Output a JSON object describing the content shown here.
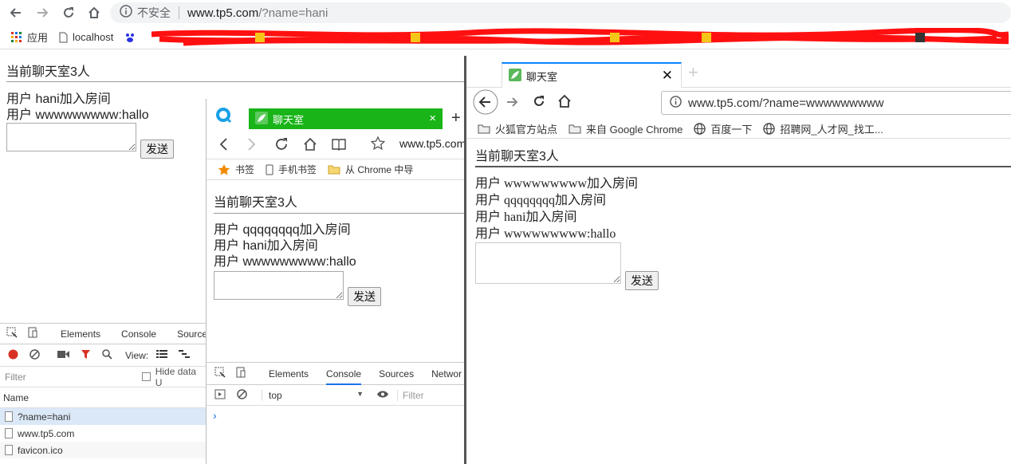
{
  "main_window": {
    "insecure_label": "不安全",
    "url_host": "www.tp5.com",
    "url_path": "/?name=hani",
    "bookmarks": [
      "应用",
      "localhost"
    ],
    "page": {
      "title": "当前聊天室3人",
      "messages": [
        "用户 hani加入房间",
        "用户 wwwwwwwww:hallo"
      ],
      "send_label": "发送"
    },
    "devtools": {
      "tabs": [
        "Elements",
        "Console",
        "Sources"
      ],
      "view_label": "View:",
      "filter_placeholder": "Filter",
      "hide_data_label": "Hide data U",
      "name_header": "Name",
      "requests": [
        "?name=hani",
        "www.tp5.com",
        "favicon.ico"
      ]
    }
  },
  "qq_window": {
    "tab_title": "聊天室",
    "new_tab": "+",
    "url": "www.tp5.com",
    "bookmarks": [
      "书签",
      "手机书签",
      "从 Chrome 中导"
    ],
    "page": {
      "title": "当前聊天室3人",
      "messages": [
        "用户 qqqqqqqq加入房间",
        "用户 hani加入房间",
        "用户 wwwwwwwww:hallo"
      ],
      "send_label": "发送"
    },
    "devtools": {
      "tabs": [
        "Elements",
        "Console",
        "Sources",
        "Networ"
      ],
      "context": "top",
      "filter_placeholder": "Filter",
      "prompt": "›"
    }
  },
  "firefox_window": {
    "tab_title": "聊天室",
    "url": "www.tp5.com/?name=wwwwwwwww",
    "bookmarks": [
      "火狐官方站点",
      "来自 Google Chrome",
      "百度一下",
      "招聘网_人才网_找工..."
    ],
    "page": {
      "title": "当前聊天室3人",
      "messages": [
        "用户 wwwwwwwww加入房间",
        "用户 qqqqqqqq加入房间",
        "用户 hani加入房间",
        "用户 wwwwwwwww:hallo"
      ],
      "send_label": "发送"
    }
  },
  "colors": {
    "qq_tab_green": "#18b418",
    "firefox_accent": "#0a84ff",
    "redaction_red": "#ff1010",
    "devtools_record": "#d93025"
  }
}
